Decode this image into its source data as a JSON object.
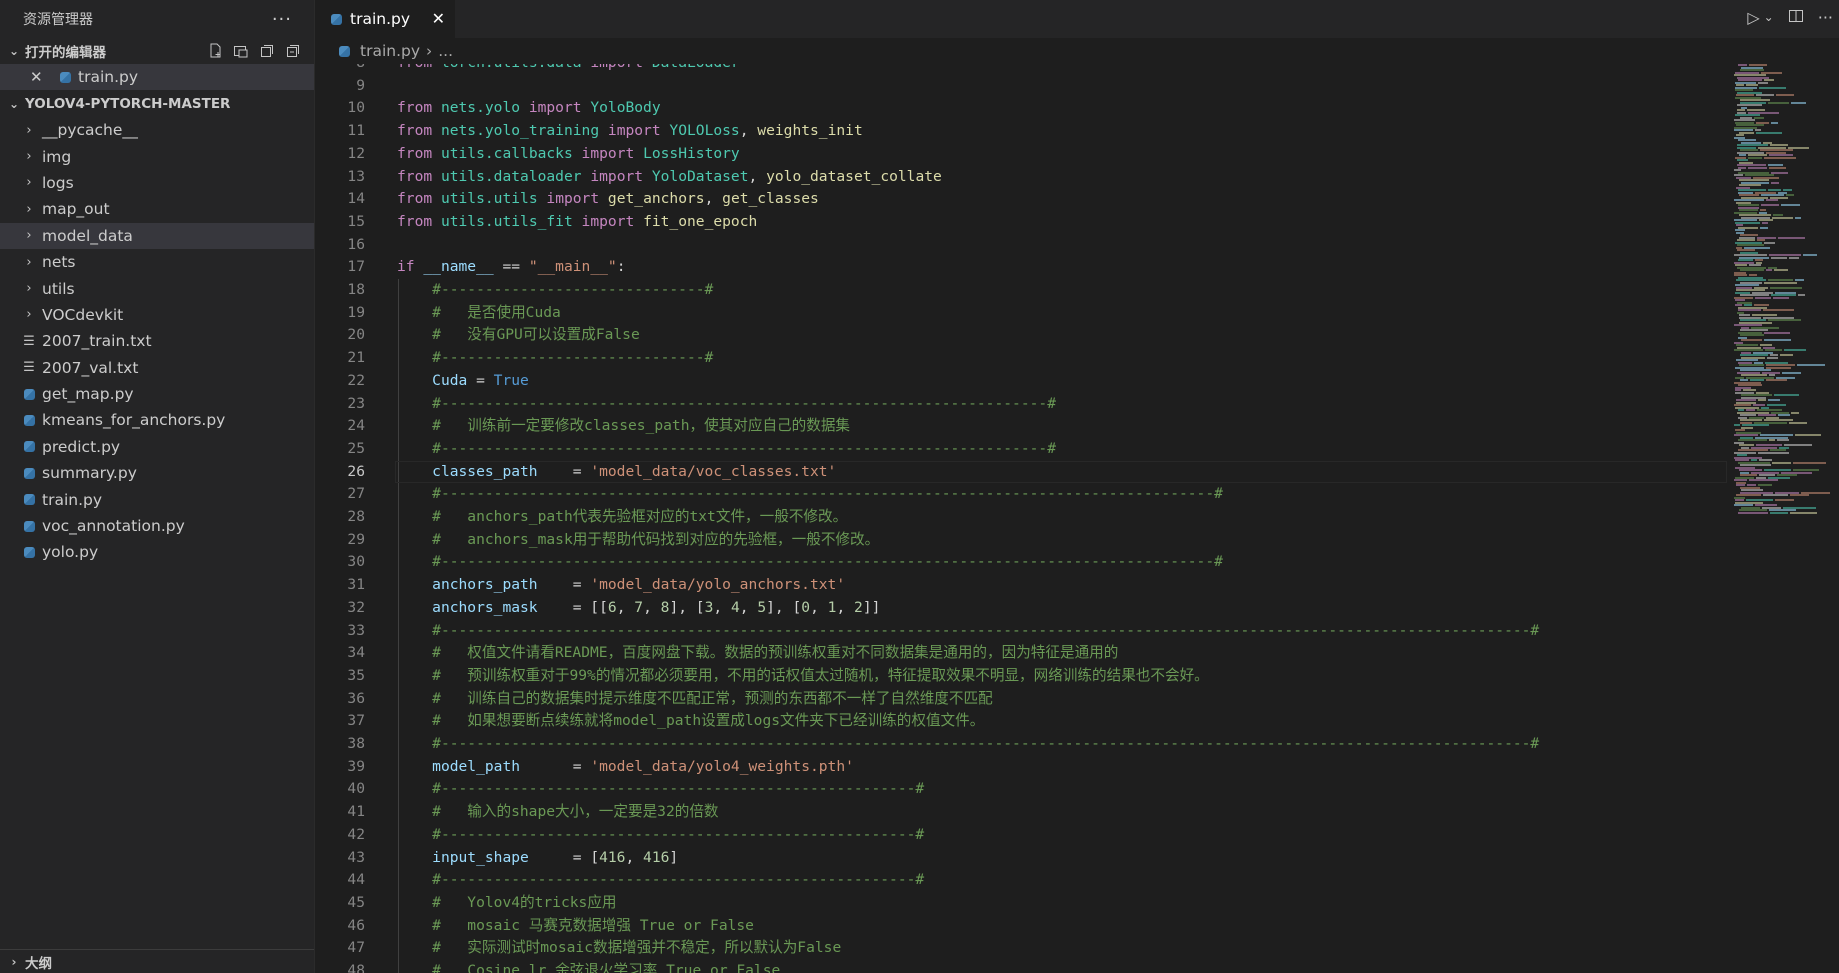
{
  "explorer": {
    "title": "资源管理器",
    "more": "···",
    "open_editors_header": "打开的编辑器",
    "open_editors": [
      {
        "name": "train.py"
      }
    ],
    "project_header": "YOLOV4-PYTORCH-MASTER",
    "tree": [
      {
        "name": "__pycache__",
        "type": "folder"
      },
      {
        "name": "img",
        "type": "folder"
      },
      {
        "name": "logs",
        "type": "folder"
      },
      {
        "name": "map_out",
        "type": "folder"
      },
      {
        "name": "model_data",
        "type": "folder",
        "selected": true
      },
      {
        "name": "nets",
        "type": "folder"
      },
      {
        "name": "utils",
        "type": "folder"
      },
      {
        "name": "VOCdevkit",
        "type": "folder"
      },
      {
        "name": "2007_train.txt",
        "type": "txt"
      },
      {
        "name": "2007_val.txt",
        "type": "txt"
      },
      {
        "name": "get_map.py",
        "type": "py"
      },
      {
        "name": "kmeans_for_anchors.py",
        "type": "py"
      },
      {
        "name": "predict.py",
        "type": "py"
      },
      {
        "name": "summary.py",
        "type": "py"
      },
      {
        "name": "train.py",
        "type": "py"
      },
      {
        "name": "voc_annotation.py",
        "type": "py"
      },
      {
        "name": "yolo.py",
        "type": "py"
      }
    ],
    "outline_header": "大纲"
  },
  "tabs": [
    {
      "label": "train.py",
      "active": true
    }
  ],
  "breadcrumb": {
    "file": "train.py",
    "more": "..."
  },
  "editor": {
    "current_line": 26,
    "lines": [
      {
        "n": "8",
        "html": "<span class=\"kw\">from</span> <span class=\"mod\">torch.utils.data</span> <span class=\"kw\">import</span> <span class=\"cls\">DataLoader</span>"
      },
      {
        "n": "9",
        "html": ""
      },
      {
        "n": "10",
        "html": "<span class=\"kw\">from</span> <span class=\"mod\">nets.yolo</span> <span class=\"kw\">import</span> <span class=\"cls\">YoloBody</span>"
      },
      {
        "n": "11",
        "html": "<span class=\"kw\">from</span> <span class=\"mod\">nets.yolo_training</span> <span class=\"kw\">import</span> <span class=\"cls\">YOLOLoss</span>, <span class=\"fn\">weights_init</span>"
      },
      {
        "n": "12",
        "html": "<span class=\"kw\">from</span> <span class=\"mod\">utils.callbacks</span> <span class=\"kw\">import</span> <span class=\"cls\">LossHistory</span>"
      },
      {
        "n": "13",
        "html": "<span class=\"kw\">from</span> <span class=\"mod\">utils.dataloader</span> <span class=\"kw\">import</span> <span class=\"cls\">YoloDataset</span>, <span class=\"fn\">yolo_dataset_collate</span>"
      },
      {
        "n": "14",
        "html": "<span class=\"kw\">from</span> <span class=\"mod\">utils.utils</span> <span class=\"kw\">import</span> <span class=\"fn\">get_anchors</span>, <span class=\"fn\">get_classes</span>"
      },
      {
        "n": "15",
        "html": "<span class=\"kw\">from</span> <span class=\"mod\">utils.utils_fit</span> <span class=\"kw\">import</span> <span class=\"fn\">fit_one_epoch</span>"
      },
      {
        "n": "16",
        "html": ""
      },
      {
        "n": "17",
        "html": "<span class=\"kw\">if</span> <span class=\"var\">__name__</span> == <span class=\"str\">\"__main__\"</span>:"
      },
      {
        "n": "18",
        "html": "    <span class=\"cm\">#------------------------------#</span>"
      },
      {
        "n": "19",
        "html": "    <span class=\"cm\">#   是否使用Cuda</span>"
      },
      {
        "n": "20",
        "html": "    <span class=\"cm\">#   没有GPU可以设置成False</span>"
      },
      {
        "n": "21",
        "html": "    <span class=\"cm\">#------------------------------#</span>"
      },
      {
        "n": "22",
        "html": "    <span class=\"var\">Cuda</span> = <span class=\"kw2\">True</span>"
      },
      {
        "n": "23",
        "html": "    <span class=\"cm\">#---------------------------------------------------------------------#</span>"
      },
      {
        "n": "24",
        "html": "    <span class=\"cm\">#   训练前一定要修改classes_path，使其对应自己的数据集</span>"
      },
      {
        "n": "25",
        "html": "    <span class=\"cm\">#---------------------------------------------------------------------#</span>"
      },
      {
        "n": "26",
        "html": "    <span class=\"var\">classes_path</span>    = <span class=\"str\">'model_data/voc_classes.txt'</span>"
      },
      {
        "n": "27",
        "html": "    <span class=\"cm\">#----------------------------------------------------------------------------------------#</span>"
      },
      {
        "n": "28",
        "html": "    <span class=\"cm\">#   anchors_path代表先验框对应的txt文件，一般不修改。</span>"
      },
      {
        "n": "29",
        "html": "    <span class=\"cm\">#   anchors_mask用于帮助代码找到对应的先验框，一般不修改。</span>"
      },
      {
        "n": "30",
        "html": "    <span class=\"cm\">#----------------------------------------------------------------------------------------#</span>"
      },
      {
        "n": "31",
        "html": "    <span class=\"var\">anchors_path</span>    = <span class=\"str\">'model_data/yolo_anchors.txt'</span>"
      },
      {
        "n": "32",
        "html": "    <span class=\"var\">anchors_mask</span>    = [[<span class=\"num-l\">6</span>, <span class=\"num-l\">7</span>, <span class=\"num-l\">8</span>], [<span class=\"num-l\">3</span>, <span class=\"num-l\">4</span>, <span class=\"num-l\">5</span>], [<span class=\"num-l\">0</span>, <span class=\"num-l\">1</span>, <span class=\"num-l\">2</span>]]"
      },
      {
        "n": "33",
        "html": "    <span class=\"cm\">#----------------------------------------------------------------------------------------------------------------------------#</span>"
      },
      {
        "n": "34",
        "html": "    <span class=\"cm\">#   权值文件请看README，百度网盘下载。数据的预训练权重对不同数据集是通用的，因为特征是通用的</span>"
      },
      {
        "n": "35",
        "html": "    <span class=\"cm\">#   预训练权重对于99%的情况都必须要用，不用的话权值太过随机，特征提取效果不明显，网络训练的结果也不会好。</span>"
      },
      {
        "n": "36",
        "html": "    <span class=\"cm\">#   训练自己的数据集时提示维度不匹配正常，预测的东西都不一样了自然维度不匹配</span>"
      },
      {
        "n": "37",
        "html": "    <span class=\"cm\">#   如果想要断点续练就将model_path设置成logs文件夹下已经训练的权值文件。</span>"
      },
      {
        "n": "38",
        "html": "    <span class=\"cm\">#----------------------------------------------------------------------------------------------------------------------------#</span>"
      },
      {
        "n": "39",
        "html": "    <span class=\"var\">model_path</span>      = <span class=\"str\">'model_data/yolo4_weights.pth'</span>"
      },
      {
        "n": "40",
        "html": "    <span class=\"cm\">#------------------------------------------------------#</span>"
      },
      {
        "n": "41",
        "html": "    <span class=\"cm\">#   输入的shape大小，一定要是32的倍数</span>"
      },
      {
        "n": "42",
        "html": "    <span class=\"cm\">#------------------------------------------------------#</span>"
      },
      {
        "n": "43",
        "html": "    <span class=\"var\">input_shape</span>     = [<span class=\"num-l\">416</span>, <span class=\"num-l\">416</span>]"
      },
      {
        "n": "44",
        "html": "    <span class=\"cm\">#------------------------------------------------------#</span>"
      },
      {
        "n": "45",
        "html": "    <span class=\"cm\">#   Yolov4的tricks应用</span>"
      },
      {
        "n": "46",
        "html": "    <span class=\"cm\">#   mosaic 马赛克数据增强 True or False</span>"
      },
      {
        "n": "47",
        "html": "    <span class=\"cm\">#   实际测试时mosaic数据增强并不稳定，所以默认为False</span>"
      },
      {
        "n": "48",
        "html": "    <span class=\"cm\">#   Cosine_lr 余弦退火学习率 True or False</span>"
      }
    ]
  },
  "colors": {
    "bg": "#1e1e1e",
    "sidebar": "#252526",
    "keyword": "#c586c0",
    "module": "#4ec9b0",
    "function": "#dcdcaa",
    "variable": "#9cdcfe",
    "string": "#ce9178",
    "comment": "#6a9955",
    "constant": "#569cd6"
  },
  "icons": {
    "new_file": "new-file-icon",
    "new_folder": "new-folder-icon",
    "refresh": "refresh-icon",
    "collapse": "collapse-all-icon",
    "run": "run-icon",
    "split": "split-editor-icon"
  }
}
